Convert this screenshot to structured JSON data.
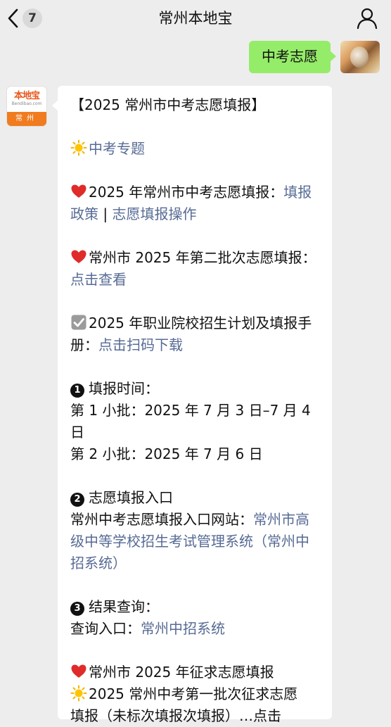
{
  "header": {
    "unread_count": "7",
    "title": "常州本地宝"
  },
  "my_message": {
    "text": "中考志愿"
  },
  "bot_avatar": {
    "logo_text": "本地宝",
    "logo_url": "Bendibao.com",
    "city": "常州"
  },
  "message": {
    "title": "【2025 常州市中考志愿填报】",
    "topic_link": "中考专题",
    "item1_text": "2025 年常州市中考志愿填报：",
    "item1_link1": "填报政策",
    "item1_sep": " | ",
    "item1_link2": "志愿填报操作",
    "item2_text": "常州市 2025 年第二批次志愿填报：",
    "item2_link": "点击查看",
    "item3_text": "2025 年职业院校招生计划及填报手册：",
    "item3_link": "点击扫码下载",
    "sec1_num": "1",
    "sec1_title": "填报时间：",
    "sec1_line1": "第 1 小批：2025 年 7 月 3 日–7 月 4 日",
    "sec1_line2": "第 2 小批：2025 年 7 月 6 日",
    "sec2_num": "2",
    "sec2_title": "志愿填报入口",
    "sec2_text": "常州中考志愿填报入口网站：",
    "sec2_link": "常州市高级中等学校招生考试管理系统（常州中招系统）",
    "sec3_num": "3",
    "sec3_title": "结果查询：",
    "sec3_text": "查询入口：",
    "sec3_link": "常州中招系统",
    "item4_text": "常州市 2025 年征求志愿填报",
    "item5_text": "2025 常州中考第一批次征求志愿",
    "item5_cont": "填报（未标次填报次填报）…点击"
  }
}
